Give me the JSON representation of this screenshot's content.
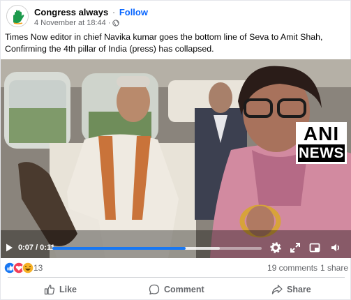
{
  "post": {
    "page_name": "Congress always",
    "separator": "·",
    "follow_label": "Follow",
    "date": "4 November at 18:44",
    "meta_separator": "·",
    "caption": "Times Now editor in chief Navika kumar goes the bottom line of Seva to Amit Shah, Confirming the 4th pillar of India (press) has collapsed."
  },
  "video": {
    "watermark_line1": "ANI",
    "watermark_line2": "NEWS",
    "time_display": "0:07 / 0:11",
    "progress_fraction": 0.636,
    "buffer_fraction": 0.8
  },
  "stats": {
    "reaction_count": "13",
    "comments": "19 comments",
    "shares": "1 share"
  },
  "actions": {
    "like": "Like",
    "comment": "Comment",
    "share": "Share"
  },
  "colors": {
    "accent": "#0866ff",
    "progress": "#1877f2",
    "muted_text": "#65676b",
    "like_blue": "#1877f2",
    "love_red": "#f33e58",
    "haha_yellow": "#f7b125"
  },
  "icons": {
    "avatar": "congress-hand-logo",
    "privacy": "globe-icon",
    "play": "play-icon",
    "settings": "gear-icon",
    "fullscreen": "expand-icon",
    "pip": "picture-in-picture-icon",
    "volume": "speaker-icon"
  }
}
